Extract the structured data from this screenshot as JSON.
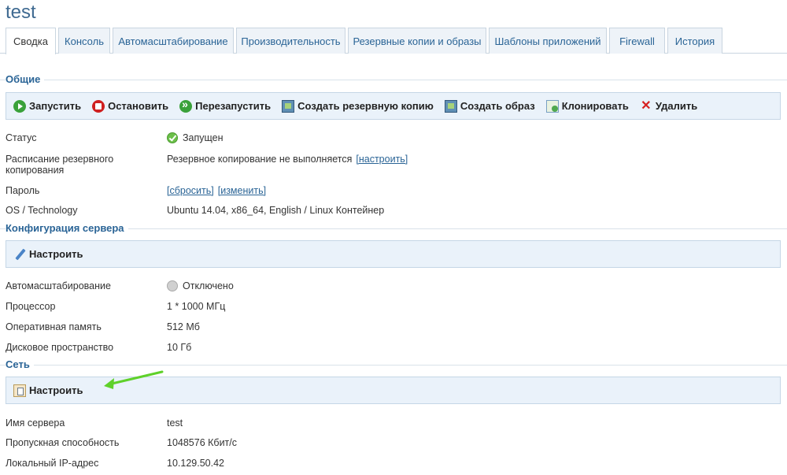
{
  "page": {
    "title": "test"
  },
  "tabs": [
    {
      "label": "Сводка",
      "active": true
    },
    {
      "label": "Консоль"
    },
    {
      "label": "Автомасштабирование"
    },
    {
      "label": "Производительность"
    },
    {
      "label": "Резервные копии и образы"
    },
    {
      "label": "Шаблоны приложений"
    },
    {
      "label": "Firewall"
    },
    {
      "label": "История"
    }
  ],
  "general": {
    "heading": "Общие",
    "toolbar": {
      "start": "Запустить",
      "stop": "Остановить",
      "restart": "Перезапустить",
      "backup": "Создать резервную копию",
      "image": "Создать образ",
      "clone": "Клонировать",
      "delete": "Удалить"
    },
    "status_label": "Статус",
    "status_value": "Запущен",
    "schedule_label": "Расписание резервного копирования",
    "schedule_value": "Резервное копирование не выполняется",
    "schedule_link": "[настроить]",
    "password_label": "Пароль",
    "password_reset": "[сбросить]",
    "password_change": "[изменить]",
    "os_label": "OS / Technology",
    "os_value": "Ubuntu 14.04, x86_64, English / Linux Контейнер"
  },
  "server_config": {
    "heading": "Конфигурация сервера",
    "configure": "Настроить",
    "autoscale_label": "Автомасштабирование",
    "autoscale_value": "Отключено",
    "cpu_label": "Процессор",
    "cpu_value": "1 * 1000 МГц",
    "ram_label": "Оперативная память",
    "ram_value": "512 Мб",
    "disk_label": "Дисковое пространство",
    "disk_value": "10 Гб"
  },
  "network": {
    "heading": "Сеть",
    "configure": "Настроить",
    "hostname_label": "Имя сервера",
    "hostname_value": "test",
    "bandwidth_label": "Пропускная способность",
    "bandwidth_value": "1048576 Кбит/с",
    "ip_label": "Локальный IP-адрес",
    "ip_value": "10.129.50.42"
  },
  "colors": {
    "accent": "#2a6496",
    "toolbar_bg": "#eaf2fa",
    "annotation_arrow": "#5fd12a"
  }
}
